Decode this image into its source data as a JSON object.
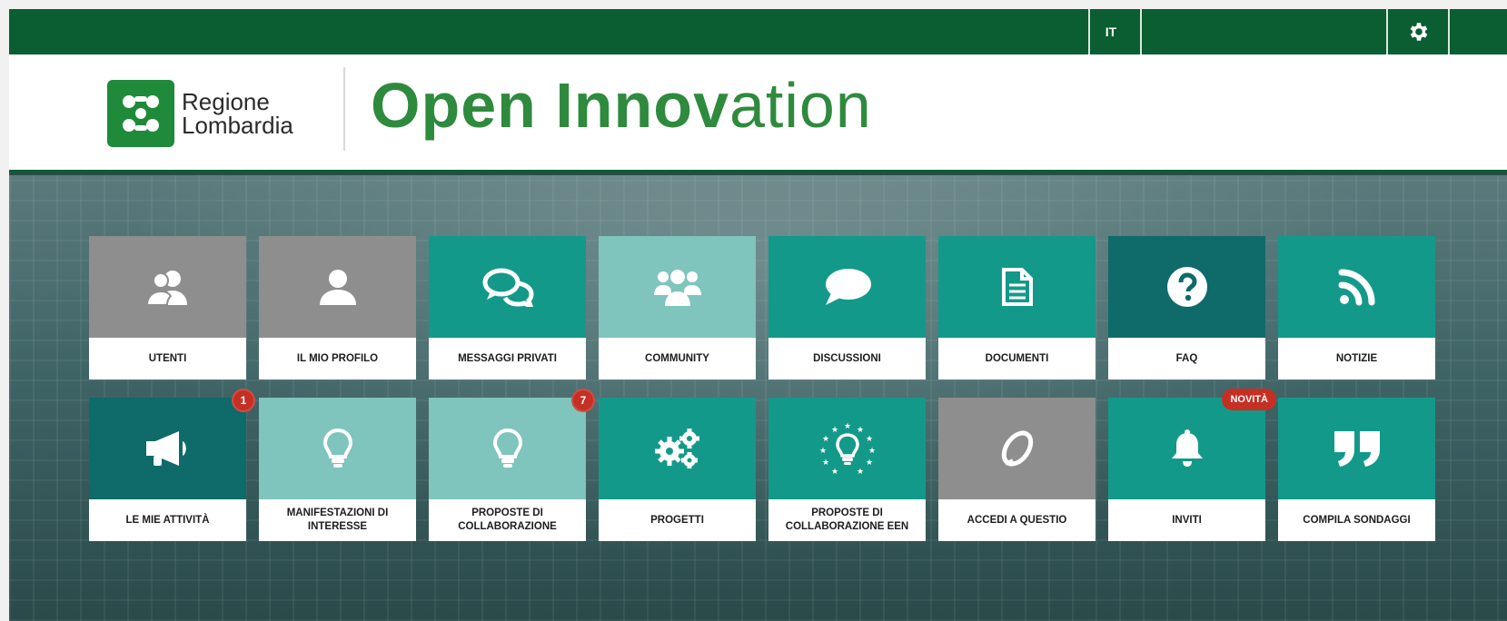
{
  "topbar": {
    "language": "IT",
    "settings_icon": "gear-icon"
  },
  "header": {
    "logo_line1": "Regione",
    "logo_line2": "Lombardia",
    "brand_bold": "Open Innov",
    "brand_light": "ation"
  },
  "tiles_row1": [
    {
      "label": "UTENTI",
      "icon": "users-icon",
      "color": "#8e8e8e"
    },
    {
      "label": "IL MIO PROFILO",
      "icon": "user-icon",
      "color": "#8e8e8e"
    },
    {
      "label": "MESSAGGI PRIVATI",
      "icon": "chat-bubbles-icon",
      "color": "#13998a"
    },
    {
      "label": "COMMUNITY",
      "icon": "group-icon",
      "color": "#7fc4bd"
    },
    {
      "label": "DISCUSSIONI",
      "icon": "speech-bubble-icon",
      "color": "#13998a"
    },
    {
      "label": "DOCUMENTI",
      "icon": "document-icon",
      "color": "#13998a"
    },
    {
      "label": "FAQ",
      "icon": "question-icon",
      "color": "#0f6a6a"
    },
    {
      "label": "NOTIZIE",
      "icon": "rss-icon",
      "color": "#13998a"
    }
  ],
  "tiles_row2": [
    {
      "label": "LE MIE ATTIVITÀ",
      "icon": "megaphone-icon",
      "color": "#0f6a6a",
      "badge": "1"
    },
    {
      "label": "MANIFESTAZIONI DI INTERESSE",
      "icon": "lightbulb-icon",
      "color": "#7fc4bd"
    },
    {
      "label": "PROPOSTE DI COLLABORAZIONE",
      "icon": "lightbulb-icon",
      "color": "#7fc4bd",
      "badge": "7"
    },
    {
      "label": "PROGETTI",
      "icon": "gears-icon",
      "color": "#13998a"
    },
    {
      "label": "PROPOSTE DI COLLABORAZIONE EEN",
      "icon": "eu-lightbulb-icon",
      "color": "#13998a"
    },
    {
      "label": "ACCEDI A QUESTIO",
      "icon": "questio-icon",
      "color": "#8e8e8e"
    },
    {
      "label": "INVITI",
      "icon": "bell-icon",
      "color": "#13998a",
      "badge_text": "NOVITÀ"
    },
    {
      "label": "COMPILA SONDAGGI",
      "icon": "quote-icon",
      "color": "#13998a"
    }
  ]
}
